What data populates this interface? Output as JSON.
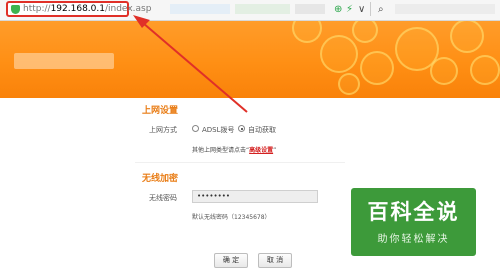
{
  "browser": {
    "url_scheme": "http://",
    "url_host": "192.168.0.1",
    "url_path": "/index.asp"
  },
  "internet": {
    "title": "上网设置",
    "mode_label": "上网方式",
    "options": [
      "ADSL拨号",
      "自动获取"
    ],
    "selected_option": "自动获取",
    "hint_prefix": "其他上网类型请点击“",
    "hint_link": "高级设置",
    "hint_suffix": "”"
  },
  "wireless": {
    "title": "无线加密",
    "password_label": "无线密码",
    "password_value": "••••••••",
    "default_note": "默认无线密码（12345678）"
  },
  "buttons": {
    "ok": "确 定",
    "cancel": "取 消"
  },
  "watermark": {
    "main": "百科全说",
    "sub": "助你轻松解决"
  },
  "colors": {
    "header_orange": "#ff9622",
    "section_title": "#e97d16",
    "link_red": "#d42020",
    "annotation_red": "#e03028",
    "watermark_green": "#3d9a3a"
  }
}
